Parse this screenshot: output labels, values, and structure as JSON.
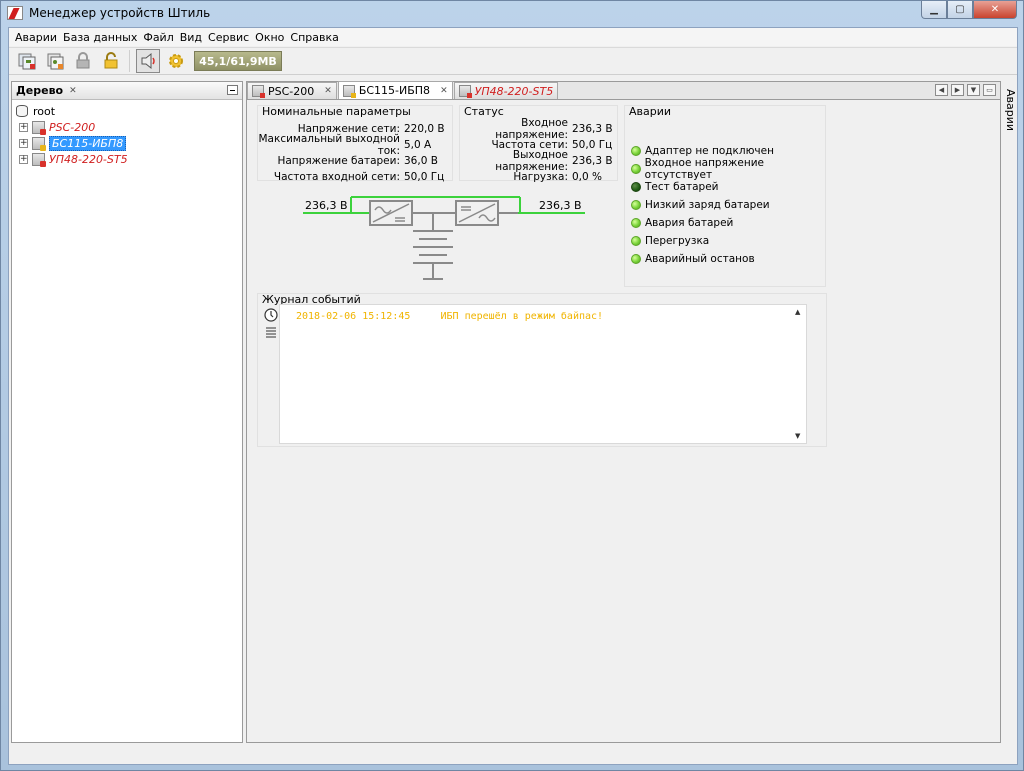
{
  "window": {
    "title": "Менеджер устройств Штиль"
  },
  "menu": [
    "Аварии",
    "База данных",
    "Файл",
    "Вид",
    "Сервис",
    "Окно",
    "Справка"
  ],
  "toolbar": {
    "memory": "45,1/61,9МВ"
  },
  "tree_panel": {
    "title": "Дерево",
    "root": "root",
    "items": [
      {
        "label": "PSC-200",
        "state": "alarm"
      },
      {
        "label": "БС115-ИБП8",
        "state": "selected"
      },
      {
        "label": "УП48-220-ST5",
        "state": "alarm"
      }
    ]
  },
  "tabs": [
    {
      "label": "PSC-200",
      "active": false
    },
    {
      "label": "БС115-ИБП8",
      "active": true
    },
    {
      "label": "УП48-220-ST5",
      "active": false
    }
  ],
  "nominal": {
    "title": "Номинальные параметры",
    "rows": [
      {
        "label": "Напряжение сети:",
        "value": "220,0 В"
      },
      {
        "label": "Максимальный выходной ток:",
        "value": "5,0 А"
      },
      {
        "label": "Напряжение батареи:",
        "value": "36,0 В"
      },
      {
        "label": "Частота входной сети:",
        "value": "50,0 Гц"
      }
    ]
  },
  "status": {
    "title": "Статус",
    "rows": [
      {
        "label": "Входное напряжение:",
        "value": "236,3 В"
      },
      {
        "label": "Частота сети:",
        "value": "50,0 Гц"
      },
      {
        "label": "Выходное напряжение:",
        "value": "236,3 В"
      },
      {
        "label": "Нагрузка:",
        "value": "0,0 %"
      }
    ]
  },
  "schematic": {
    "input_voltage": "236,3 В",
    "output_voltage": "236,3 В"
  },
  "alarms": {
    "title": "Аварии",
    "items": [
      {
        "label": "Адаптер не подключен",
        "active": false
      },
      {
        "label": "Входное напряжение отсутствует",
        "active": false
      },
      {
        "label": "Тест батарей",
        "active": true
      },
      {
        "label": "Низкий заряд батареи",
        "active": false
      },
      {
        "label": "Авария батарей",
        "active": false
      },
      {
        "label": "Перегрузка",
        "active": false
      },
      {
        "label": "Аварийный останов",
        "active": false
      }
    ]
  },
  "log": {
    "title": "Журнал событий",
    "entries": [
      {
        "time": "2018-02-06 15:12:45",
        "text": "ИБП перешёл в режим байпас!"
      }
    ]
  },
  "side_tab": {
    "label": "Аварии"
  },
  "colors": {
    "alarm_text": "#d01f1f",
    "selected": "#3399ff",
    "line_green": "#3cd23c",
    "log_text": "#f0b400"
  }
}
